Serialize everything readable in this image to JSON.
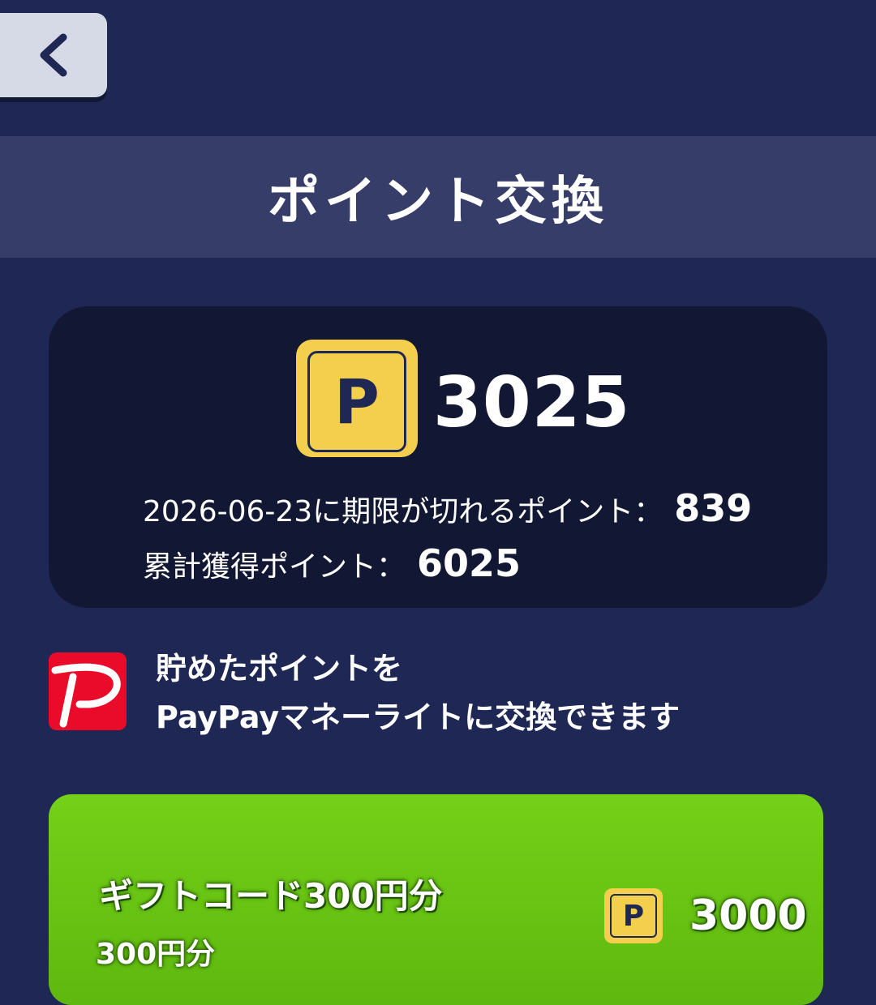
{
  "header": {
    "back_icon": "chevron-left-icon",
    "title": "ポイント交換"
  },
  "points": {
    "badge_letter": "P",
    "balance": "3025",
    "expiry_label": "2026-06-23に期限が切れるポイント：",
    "expiry_value": "839",
    "total_label": "累計獲得ポイント：",
    "total_value": "6025"
  },
  "paypay": {
    "logo_icon": "paypay-logo-icon",
    "notice_line1": "貯めたポイントを",
    "notice_line2": "PayPayマネーライトに交換できます"
  },
  "offers": [
    {
      "title": "ギフトコード300円分",
      "subtitle": "300円分",
      "badge_letter": "P",
      "cost": "3000"
    }
  ],
  "colors": {
    "background": "#1f2854",
    "title_bar": "#353d68",
    "card": "#121833",
    "point_badge": "#f4cf4e",
    "paypay_red": "#ea0a2a",
    "offer_green": "#6cc414"
  }
}
